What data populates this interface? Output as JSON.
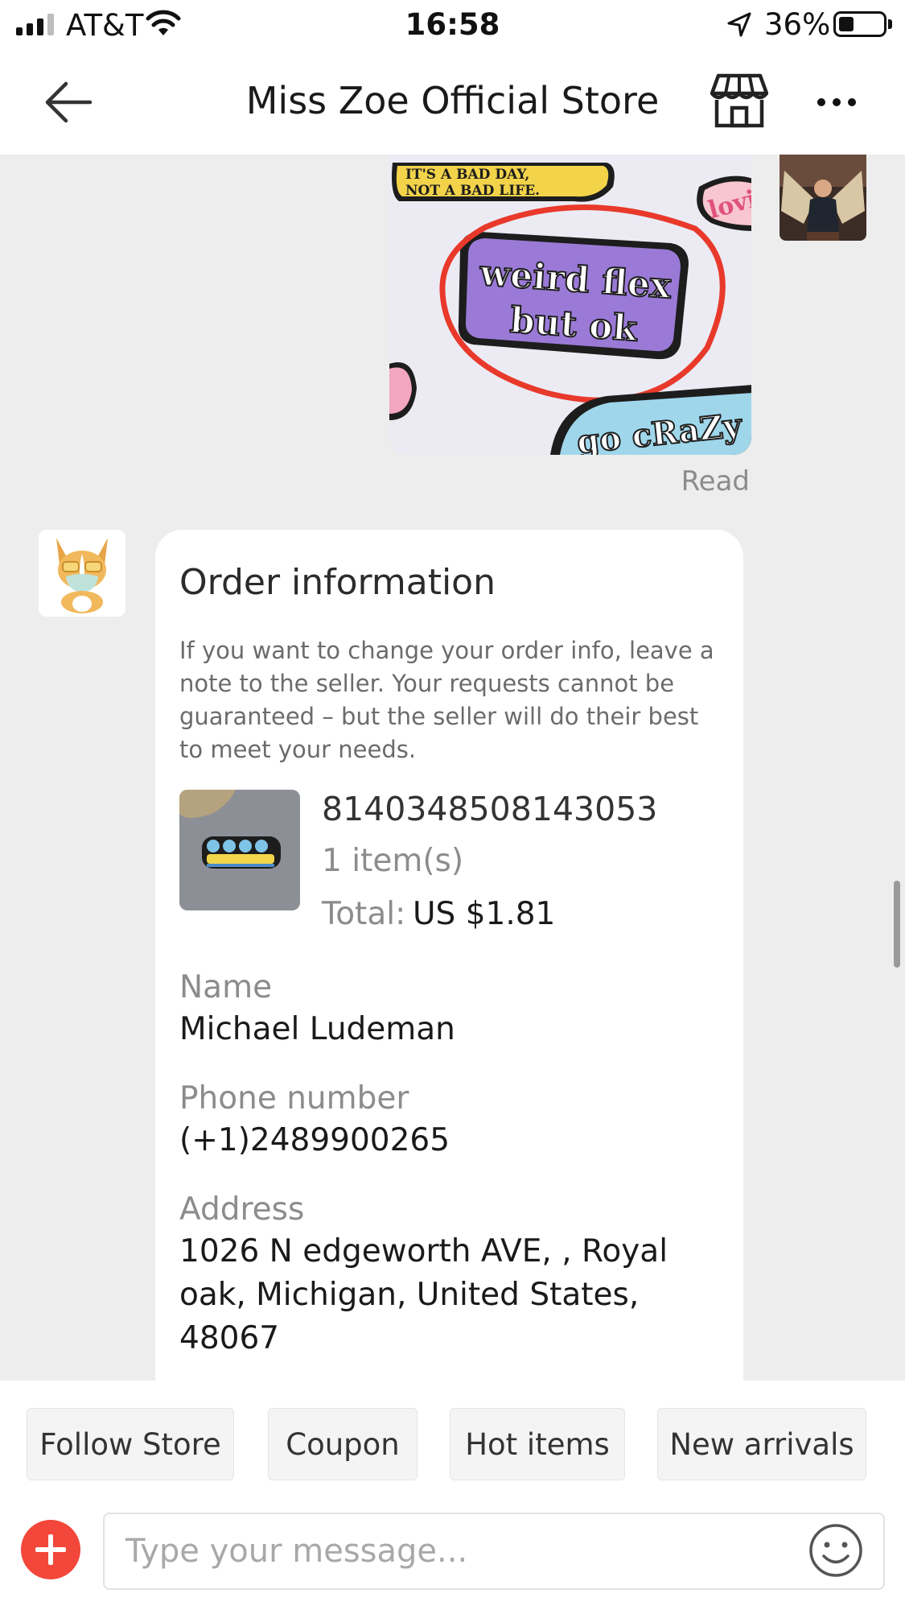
{
  "status_bar": {
    "carrier": "AT&T",
    "time": "16:58",
    "battery_percent": "36%",
    "signal_bars": 3,
    "icons": [
      "signal-icon",
      "wifi-icon",
      "location-arrow-icon",
      "battery-icon"
    ]
  },
  "header": {
    "title": "Miss Zoe Official Store",
    "icons": [
      "back-arrow-icon",
      "store-icon",
      "more-icon"
    ]
  },
  "chat": {
    "sent_image": {
      "texts": [
        "IT'S A BAD DAY,",
        "NOT A BAD LIFE.",
        "weird flex",
        "but ok",
        "go cRaZy",
        "lovi"
      ]
    },
    "read_status": "Read",
    "order_card": {
      "title": "Order information",
      "note": "If you want to change your order info, leave a note to the seller. Your requests cannot be guaranteed – but the seller will do their best to meet your needs.",
      "order_number": "8140348508143053",
      "item_count": "1 item(s)",
      "total_label": "Total:",
      "total_value": "US $1.81",
      "name_label": "Name",
      "name_value": "Michael Ludeman",
      "phone_label": "Phone number",
      "phone_value": "(+1)2489900265",
      "address_label": "Address",
      "address_value": "1026 N edgeworth AVE, , Royal oak, Michigan, United States, 48067"
    }
  },
  "quick_replies": [
    "Follow Store",
    "Coupon",
    "Hot items",
    "New arrivals"
  ],
  "composer": {
    "placeholder": "Type your message...",
    "icons": [
      "plus-icon",
      "emoji-icon"
    ]
  },
  "colors": {
    "accent_red": "#f2473a",
    "chat_background": "#ededed",
    "pin_purple": "#9a7ad6",
    "circle_red": "#e8392b"
  }
}
